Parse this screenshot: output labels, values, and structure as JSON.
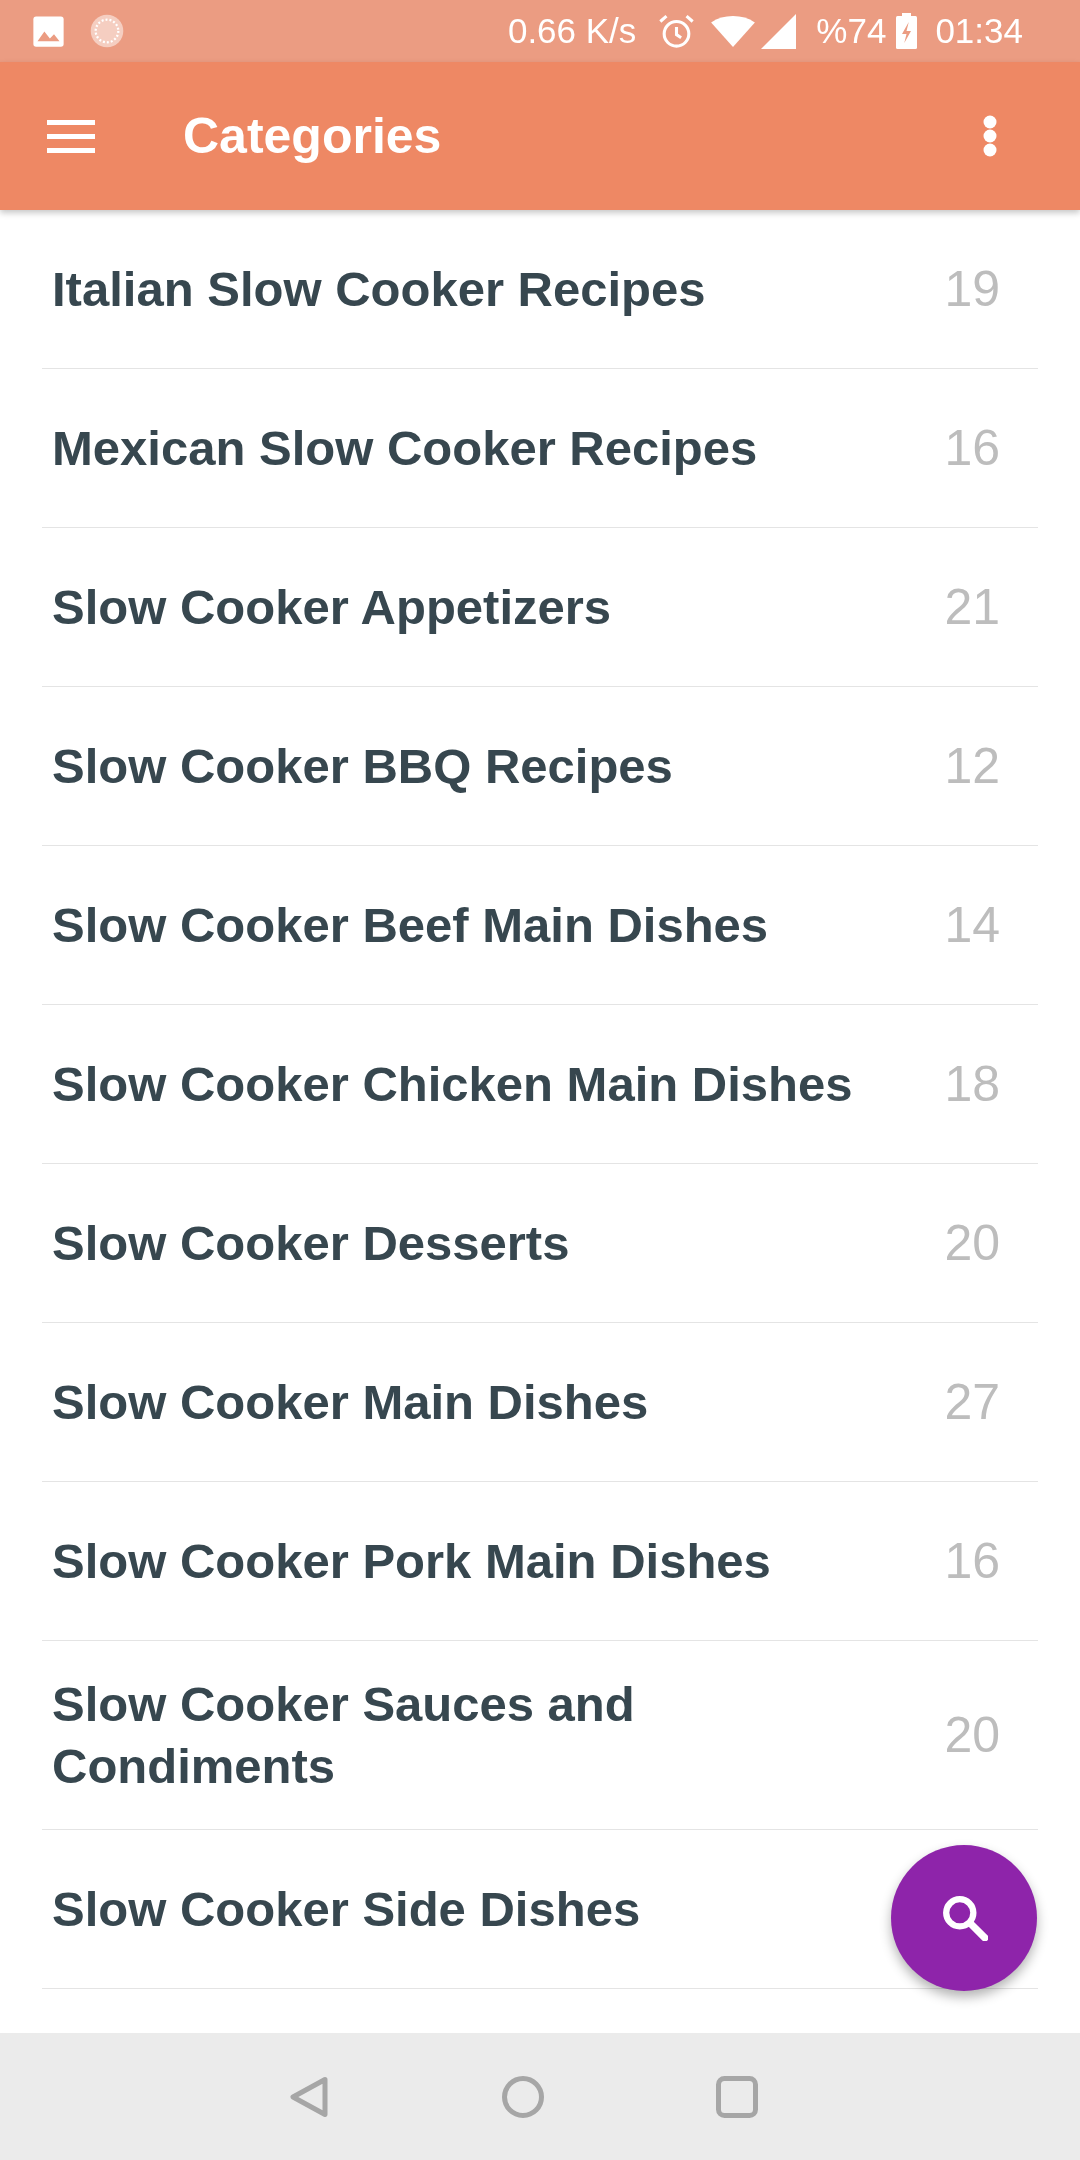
{
  "status_bar": {
    "net_speed": "0.66 K/s",
    "battery_percent": "%74",
    "time": "01:34"
  },
  "app_bar": {
    "title": "Categories"
  },
  "categories": [
    {
      "name": "Italian Slow Cooker Recipes",
      "count": "19"
    },
    {
      "name": "Mexican Slow Cooker Recipes",
      "count": "16"
    },
    {
      "name": "Slow Cooker Appetizers",
      "count": "21"
    },
    {
      "name": "Slow Cooker BBQ Recipes",
      "count": "12"
    },
    {
      "name": "Slow Cooker Beef Main Dishes",
      "count": "14"
    },
    {
      "name": "Slow Cooker Chicken Main Dishes",
      "count": "18"
    },
    {
      "name": "Slow Cooker Desserts",
      "count": "20"
    },
    {
      "name": "Slow Cooker Main Dishes",
      "count": "27"
    },
    {
      "name": "Slow Cooker Pork Main Dishes",
      "count": "16"
    },
    {
      "name": "Slow Cooker Sauces and Condiments",
      "count": "20"
    },
    {
      "name": "Slow Cooker Side Dishes"
    }
  ]
}
